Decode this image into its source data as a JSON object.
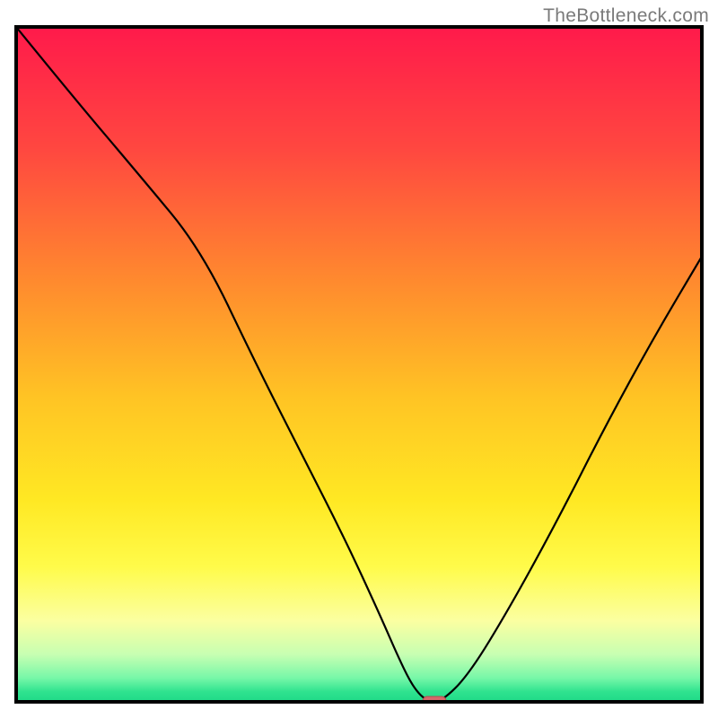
{
  "watermark": "TheBottleneck.com",
  "chart_data": {
    "type": "line",
    "title": "",
    "xlabel": "",
    "ylabel": "",
    "xlim": [
      0,
      100
    ],
    "ylim": [
      0,
      100
    ],
    "legend": null,
    "axes": {
      "border_visible": true,
      "border_color": "#000000",
      "ticks_visible": false,
      "grid": false
    },
    "background_gradient": {
      "type": "vertical",
      "stops": [
        {
          "pos": 0.0,
          "color": "#ff1a4b"
        },
        {
          "pos": 0.18,
          "color": "#ff4740"
        },
        {
          "pos": 0.38,
          "color": "#ff8b2e"
        },
        {
          "pos": 0.55,
          "color": "#ffc424"
        },
        {
          "pos": 0.7,
          "color": "#ffe823"
        },
        {
          "pos": 0.8,
          "color": "#fffb4a"
        },
        {
          "pos": 0.88,
          "color": "#fbffa1"
        },
        {
          "pos": 0.93,
          "color": "#c7ffb2"
        },
        {
          "pos": 0.965,
          "color": "#76f7a8"
        },
        {
          "pos": 0.985,
          "color": "#2fe38f"
        },
        {
          "pos": 1.0,
          "color": "#1fd987"
        }
      ]
    },
    "series": [
      {
        "name": "bottleneck-curve",
        "color": "#000000",
        "x": [
          0,
          8,
          18,
          27,
          35,
          42,
          48,
          53,
          56,
          58,
          60,
          62,
          66,
          72,
          79,
          86,
          93,
          100
        ],
        "y": [
          100,
          90,
          78,
          67,
          50,
          36,
          24,
          13,
          6,
          2,
          0,
          0,
          4,
          14,
          27,
          41,
          54,
          66
        ]
      }
    ],
    "marker": {
      "name": "optimal-point",
      "x": 61,
      "y": 0,
      "shape": "rounded-rect",
      "fill": "#d4696b",
      "stroke": "#b24d50"
    }
  }
}
